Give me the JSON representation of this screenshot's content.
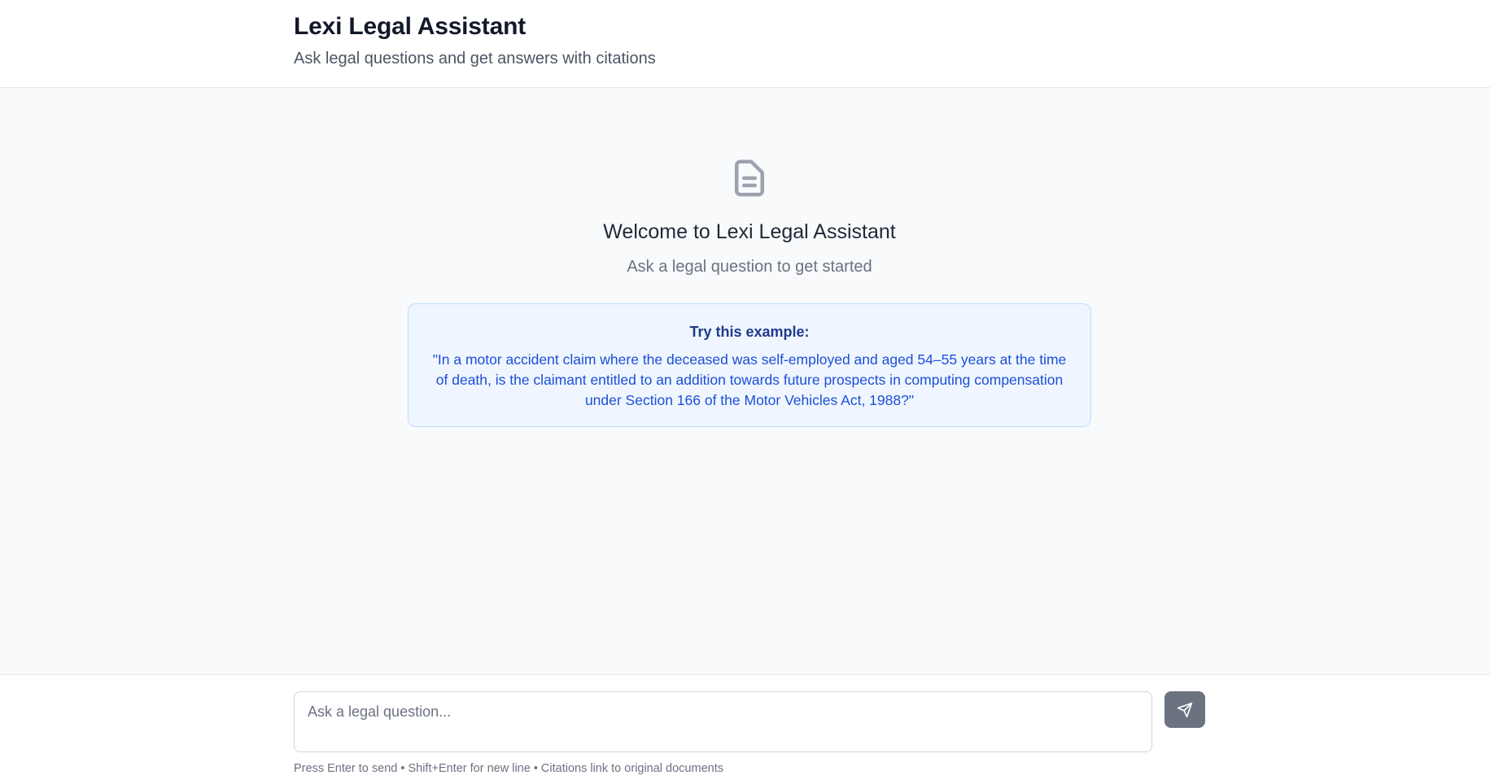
{
  "header": {
    "title": "Lexi Legal Assistant",
    "subtitle": "Ask legal questions and get answers with citations"
  },
  "welcome": {
    "icon": "document-icon",
    "title": "Welcome to Lexi Legal Assistant",
    "subtitle": "Ask a legal question to get started"
  },
  "example": {
    "label": "Try this example:",
    "text": "\"In a motor accident claim where the deceased was self-employed and aged 54–55 years at the time of death, is the claimant entitled to an addition towards future prospects in computing compensation under Section 166 of the Motor Vehicles Act, 1988?\""
  },
  "composer": {
    "placeholder": "Ask a legal question...",
    "value": "",
    "send_icon": "send-icon",
    "hint": "Press Enter to send • Shift+Enter for new line • Citations link to original documents"
  },
  "colors": {
    "example_bg": "#eff6ff",
    "example_border": "#bfdbfe",
    "example_text": "#1d4ed8",
    "send_button": "#6b7280"
  }
}
